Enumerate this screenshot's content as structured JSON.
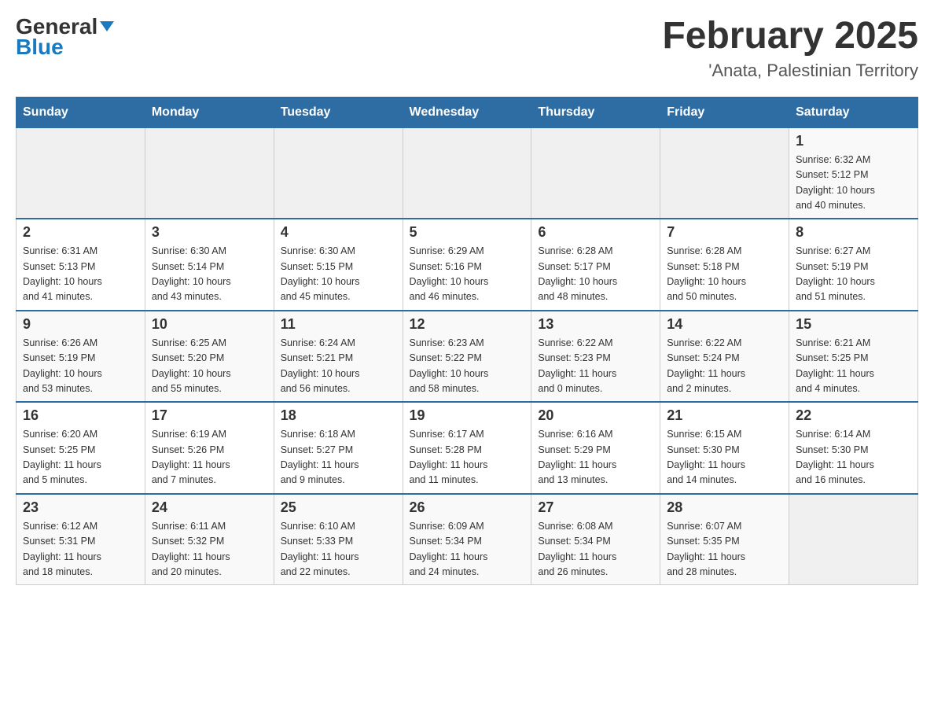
{
  "header": {
    "logo_general": "General",
    "logo_blue": "Blue",
    "title": "February 2025",
    "subtitle": "'Anata, Palestinian Territory"
  },
  "days_of_week": [
    "Sunday",
    "Monday",
    "Tuesday",
    "Wednesday",
    "Thursday",
    "Friday",
    "Saturday"
  ],
  "weeks": [
    {
      "cells": [
        {
          "day": "",
          "info": ""
        },
        {
          "day": "",
          "info": ""
        },
        {
          "day": "",
          "info": ""
        },
        {
          "day": "",
          "info": ""
        },
        {
          "day": "",
          "info": ""
        },
        {
          "day": "",
          "info": ""
        },
        {
          "day": "1",
          "info": "Sunrise: 6:32 AM\nSunset: 5:12 PM\nDaylight: 10 hours\nand 40 minutes."
        }
      ]
    },
    {
      "cells": [
        {
          "day": "2",
          "info": "Sunrise: 6:31 AM\nSunset: 5:13 PM\nDaylight: 10 hours\nand 41 minutes."
        },
        {
          "day": "3",
          "info": "Sunrise: 6:30 AM\nSunset: 5:14 PM\nDaylight: 10 hours\nand 43 minutes."
        },
        {
          "day": "4",
          "info": "Sunrise: 6:30 AM\nSunset: 5:15 PM\nDaylight: 10 hours\nand 45 minutes."
        },
        {
          "day": "5",
          "info": "Sunrise: 6:29 AM\nSunset: 5:16 PM\nDaylight: 10 hours\nand 46 minutes."
        },
        {
          "day": "6",
          "info": "Sunrise: 6:28 AM\nSunset: 5:17 PM\nDaylight: 10 hours\nand 48 minutes."
        },
        {
          "day": "7",
          "info": "Sunrise: 6:28 AM\nSunset: 5:18 PM\nDaylight: 10 hours\nand 50 minutes."
        },
        {
          "day": "8",
          "info": "Sunrise: 6:27 AM\nSunset: 5:19 PM\nDaylight: 10 hours\nand 51 minutes."
        }
      ]
    },
    {
      "cells": [
        {
          "day": "9",
          "info": "Sunrise: 6:26 AM\nSunset: 5:19 PM\nDaylight: 10 hours\nand 53 minutes."
        },
        {
          "day": "10",
          "info": "Sunrise: 6:25 AM\nSunset: 5:20 PM\nDaylight: 10 hours\nand 55 minutes."
        },
        {
          "day": "11",
          "info": "Sunrise: 6:24 AM\nSunset: 5:21 PM\nDaylight: 10 hours\nand 56 minutes."
        },
        {
          "day": "12",
          "info": "Sunrise: 6:23 AM\nSunset: 5:22 PM\nDaylight: 10 hours\nand 58 minutes."
        },
        {
          "day": "13",
          "info": "Sunrise: 6:22 AM\nSunset: 5:23 PM\nDaylight: 11 hours\nand 0 minutes."
        },
        {
          "day": "14",
          "info": "Sunrise: 6:22 AM\nSunset: 5:24 PM\nDaylight: 11 hours\nand 2 minutes."
        },
        {
          "day": "15",
          "info": "Sunrise: 6:21 AM\nSunset: 5:25 PM\nDaylight: 11 hours\nand 4 minutes."
        }
      ]
    },
    {
      "cells": [
        {
          "day": "16",
          "info": "Sunrise: 6:20 AM\nSunset: 5:25 PM\nDaylight: 11 hours\nand 5 minutes."
        },
        {
          "day": "17",
          "info": "Sunrise: 6:19 AM\nSunset: 5:26 PM\nDaylight: 11 hours\nand 7 minutes."
        },
        {
          "day": "18",
          "info": "Sunrise: 6:18 AM\nSunset: 5:27 PM\nDaylight: 11 hours\nand 9 minutes."
        },
        {
          "day": "19",
          "info": "Sunrise: 6:17 AM\nSunset: 5:28 PM\nDaylight: 11 hours\nand 11 minutes."
        },
        {
          "day": "20",
          "info": "Sunrise: 6:16 AM\nSunset: 5:29 PM\nDaylight: 11 hours\nand 13 minutes."
        },
        {
          "day": "21",
          "info": "Sunrise: 6:15 AM\nSunset: 5:30 PM\nDaylight: 11 hours\nand 14 minutes."
        },
        {
          "day": "22",
          "info": "Sunrise: 6:14 AM\nSunset: 5:30 PM\nDaylight: 11 hours\nand 16 minutes."
        }
      ]
    },
    {
      "cells": [
        {
          "day": "23",
          "info": "Sunrise: 6:12 AM\nSunset: 5:31 PM\nDaylight: 11 hours\nand 18 minutes."
        },
        {
          "day": "24",
          "info": "Sunrise: 6:11 AM\nSunset: 5:32 PM\nDaylight: 11 hours\nand 20 minutes."
        },
        {
          "day": "25",
          "info": "Sunrise: 6:10 AM\nSunset: 5:33 PM\nDaylight: 11 hours\nand 22 minutes."
        },
        {
          "day": "26",
          "info": "Sunrise: 6:09 AM\nSunset: 5:34 PM\nDaylight: 11 hours\nand 24 minutes."
        },
        {
          "day": "27",
          "info": "Sunrise: 6:08 AM\nSunset: 5:34 PM\nDaylight: 11 hours\nand 26 minutes."
        },
        {
          "day": "28",
          "info": "Sunrise: 6:07 AM\nSunset: 5:35 PM\nDaylight: 11 hours\nand 28 minutes."
        },
        {
          "day": "",
          "info": ""
        }
      ]
    }
  ]
}
